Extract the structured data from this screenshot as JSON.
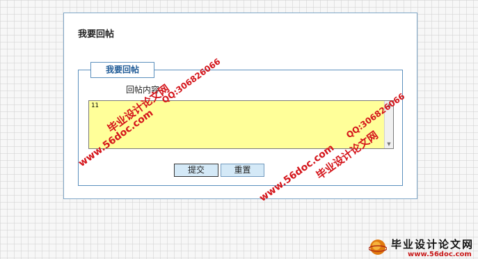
{
  "page": {
    "title": "我要回帖"
  },
  "form": {
    "legend": "我要回帖",
    "content_label": "回帖内容",
    "content_value": "11",
    "submit_label": "提交",
    "reset_label": "重置"
  },
  "watermarks": {
    "site_name": "毕业设计论文网",
    "url": "www.56doc.com",
    "qq": "QQ:306826066"
  },
  "logo": {
    "text": "毕业设计论文网",
    "url": "www.56doc.com"
  },
  "colors": {
    "textarea_bg": "#ffff99",
    "accent_border": "#5a8fbd",
    "legend_text": "#1e5a96",
    "button_bg": "#d4e9f7",
    "watermark_red": "#d4141a"
  }
}
